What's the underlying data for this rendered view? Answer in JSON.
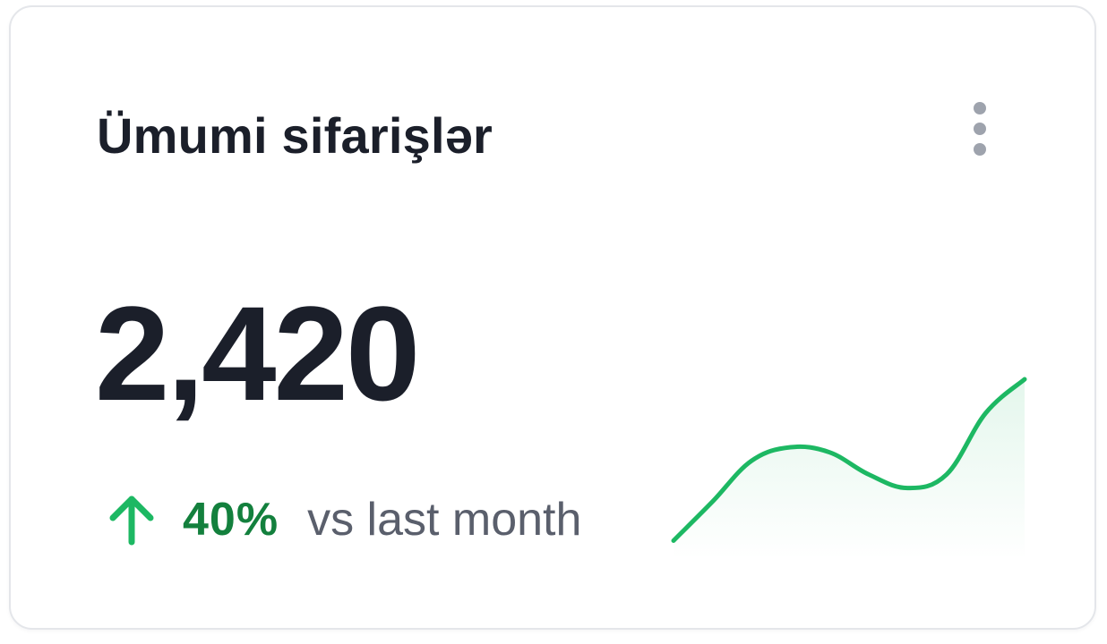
{
  "card": {
    "title": "Ümumi sifarişlər",
    "value": "2,420",
    "change_percent": "40%",
    "change_label": "vs last month",
    "trend_direction": "up",
    "menu_icon": "more-vertical-icon"
  },
  "colors": {
    "title": "#1b1f2a",
    "positive": "#13803d",
    "sparkline_stroke": "#1db863",
    "muted_text": "#5a5f6c"
  },
  "chart_data": {
    "type": "area",
    "series": [
      {
        "values": [
          0.05,
          0.28,
          0.52,
          0.6,
          0.57,
          0.44,
          0.36,
          0.44,
          0.8,
          1.0
        ]
      }
    ]
  }
}
